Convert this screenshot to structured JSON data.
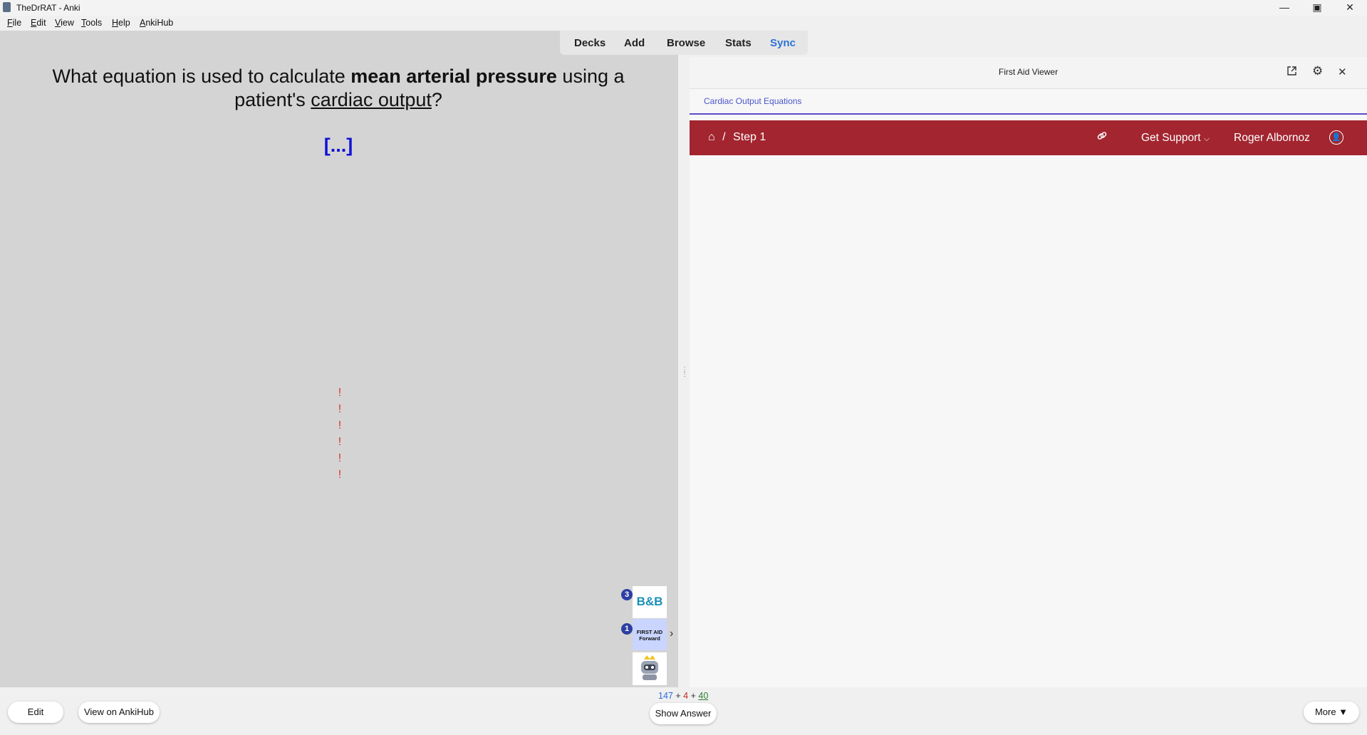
{
  "window": {
    "title": "TheDrRAT - Anki"
  },
  "menu": [
    {
      "acc": "F",
      "rest": "ile"
    },
    {
      "acc": "E",
      "rest": "dit"
    },
    {
      "acc": "V",
      "rest": "iew"
    },
    {
      "acc": "T",
      "rest": "ools"
    },
    {
      "acc": "H",
      "rest": "elp"
    },
    {
      "acc": "A",
      "rest": "nkiHub"
    }
  ],
  "toolbar": {
    "decks": "Decks",
    "add": "Add",
    "browse": "Browse",
    "stats": "Stats",
    "sync": "Sync"
  },
  "card": {
    "q1": "What equation is used to calculate ",
    "q_bold": "mean arterial pressure",
    "q2": " using a patient's ",
    "q_underline": "cardiac output",
    "q3": "?",
    "cloze": "[...]",
    "marks": [
      "!",
      "!",
      "!",
      "!",
      "!",
      "!"
    ]
  },
  "sidebar": {
    "bb_badge": "3",
    "bb_label": "B&B",
    "fa_badge": "1",
    "fa_label_1": "FIRST AID",
    "fa_label_2": "Forward",
    "arrow": "›"
  },
  "panel": {
    "title": "First Aid Viewer",
    "tab": "Cardiac Output Equations",
    "breadcrumb_sep": "/",
    "breadcrumb": "Step 1",
    "support": "Get Support",
    "user": "Roger Albornoz"
  },
  "bottom": {
    "edit": "Edit",
    "view_hub": "View on AnkiHub",
    "show_answer": "Show Answer",
    "more": "More ▼",
    "new": "147",
    "learn": "4",
    "review": "40",
    "plus": "+"
  },
  "colors": {
    "sync": "#2c73d8",
    "redbar": "#a2252f",
    "cloze": "#1010d8",
    "badge": "#2d3ea3"
  }
}
